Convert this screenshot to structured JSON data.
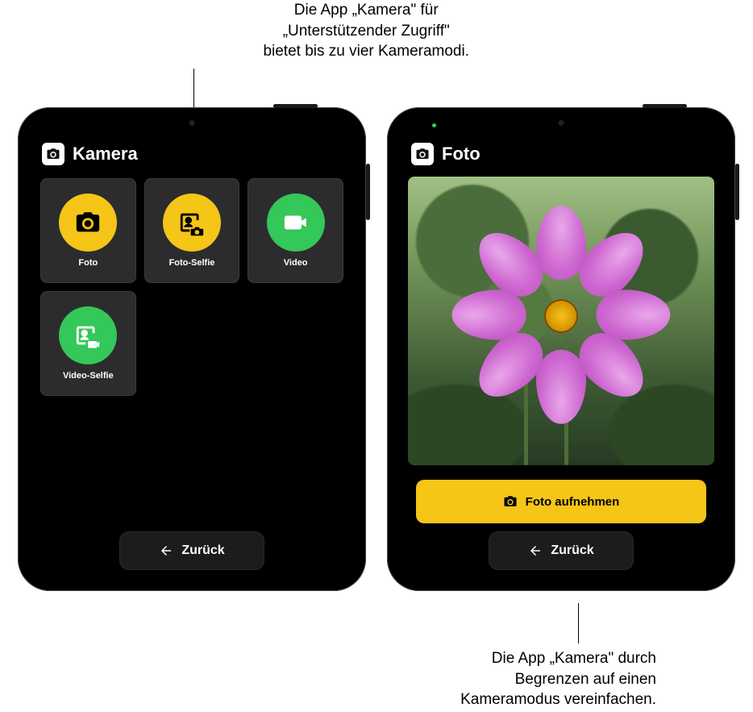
{
  "callouts": {
    "top": "Die App „Kamera\" für\n„Unterstützender Zugriff\"\nbietet bis zu vier Kameramodi.",
    "bottom": "Die App „Kamera\" durch\nBegrenzen auf einen\nKameramodus vereinfachen."
  },
  "left_device": {
    "header_title": "Kamera",
    "modes": [
      {
        "label": "Foto",
        "color": "yellow",
        "icon": "camera"
      },
      {
        "label": "Foto-Selfie",
        "color": "yellow",
        "icon": "selfie-camera"
      },
      {
        "label": "Video",
        "color": "green",
        "icon": "video"
      },
      {
        "label": "Video-Selfie",
        "color": "green",
        "icon": "selfie-video"
      }
    ],
    "back_label": "Zurück"
  },
  "right_device": {
    "header_title": "Foto",
    "take_photo_label": "Foto aufnehmen",
    "back_label": "Zurück"
  },
  "colors": {
    "yellow": "#f5c518",
    "green": "#34c759"
  }
}
